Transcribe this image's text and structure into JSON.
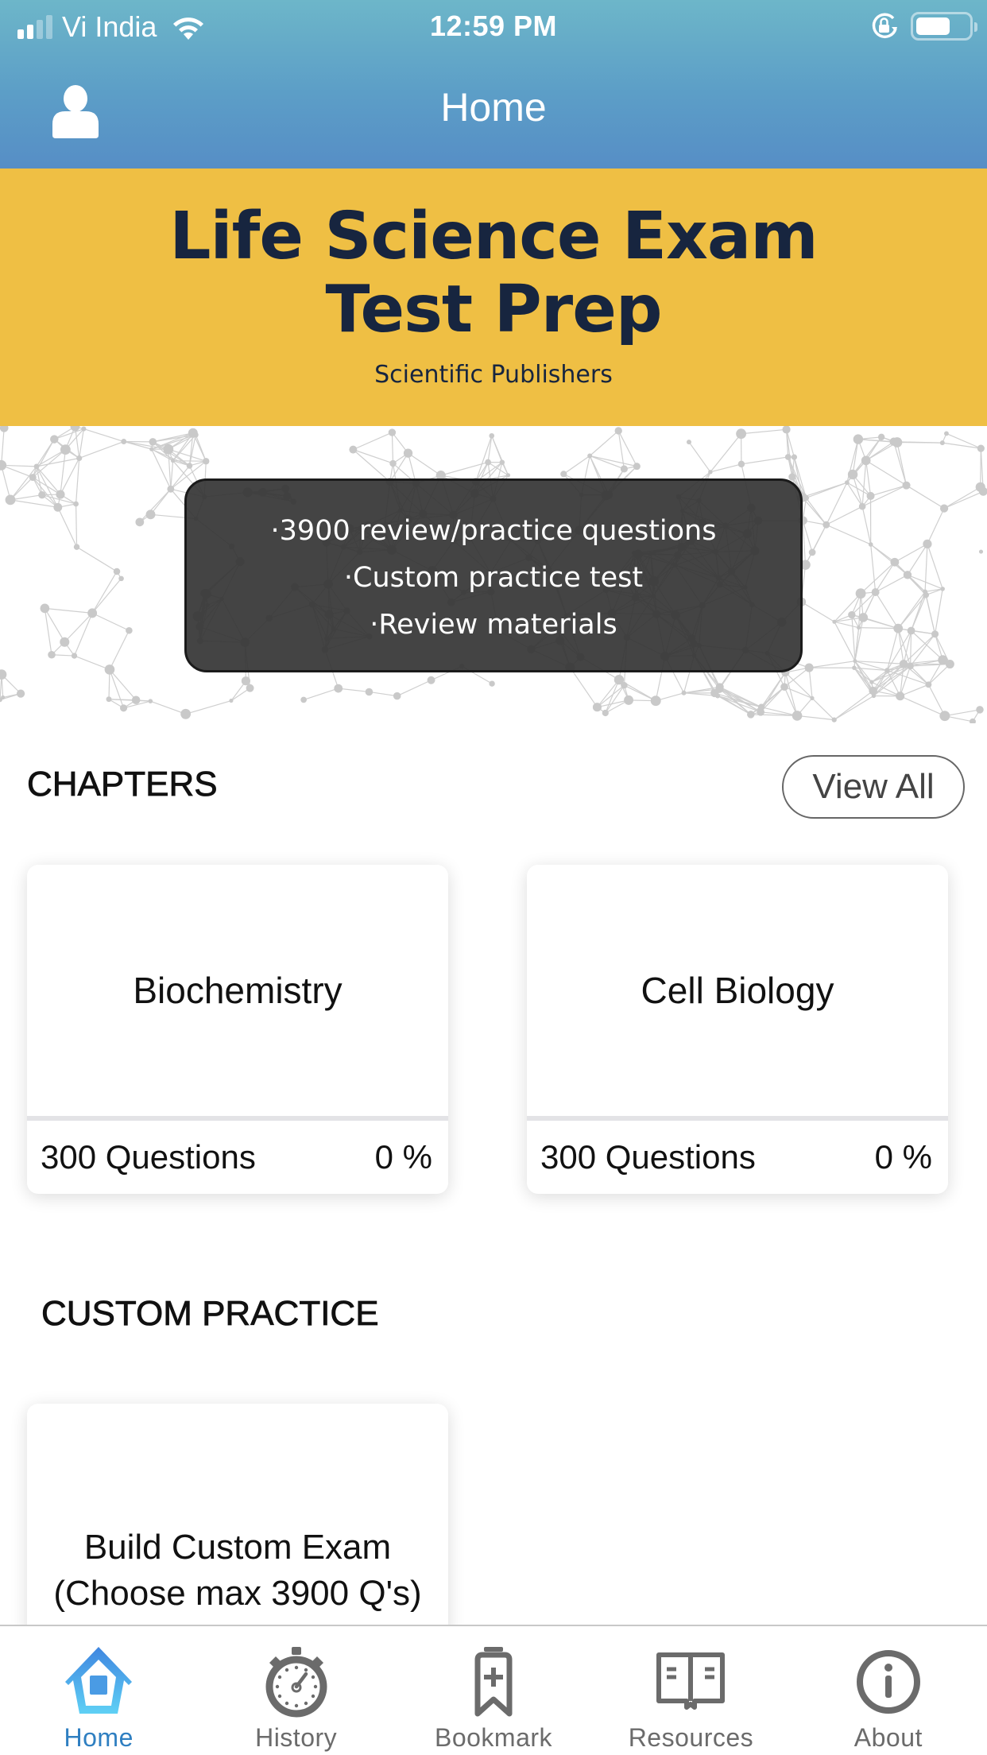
{
  "status_bar": {
    "carrier": "Vi India",
    "time": "12:59 PM",
    "signal_bars_active": 2,
    "signal_bars_total": 4,
    "battery_level": 0.65
  },
  "nav": {
    "title": "Home",
    "profile_icon": "user-icon"
  },
  "banner": {
    "title_line1": "Life Science Exam",
    "title_line2": "Test Prep",
    "subtitle": "Scientific Publishers",
    "bg_color": "#efbf44",
    "text_color": "#17253f"
  },
  "features": [
    "·3900 review/practice questions",
    "·Custom practice test",
    "·Review materials"
  ],
  "chapters": {
    "heading": "CHAPTERS",
    "view_all_label": "View All",
    "items": [
      {
        "name": "Biochemistry",
        "questions": "300 Questions",
        "progress": "0 %"
      },
      {
        "name": "Cell Biology",
        "questions": "300 Questions",
        "progress": "0 %"
      }
    ]
  },
  "custom_practice": {
    "heading": "CUSTOM PRACTICE",
    "card_line1": "Build Custom Exam",
    "card_line2": "(Choose max 3900 Q's)"
  },
  "tab_bar": {
    "active_color": "#2f7fc1",
    "inactive_color": "#6b6b6b",
    "tabs": [
      {
        "label": "Home",
        "icon": "home-icon",
        "active": true
      },
      {
        "label": "History",
        "icon": "stopwatch-icon",
        "active": false
      },
      {
        "label": "Bookmark",
        "icon": "bookmark-add-icon",
        "active": false
      },
      {
        "label": "Resources",
        "icon": "open-book-icon",
        "active": false
      },
      {
        "label": "About",
        "icon": "info-icon",
        "active": false
      }
    ]
  }
}
